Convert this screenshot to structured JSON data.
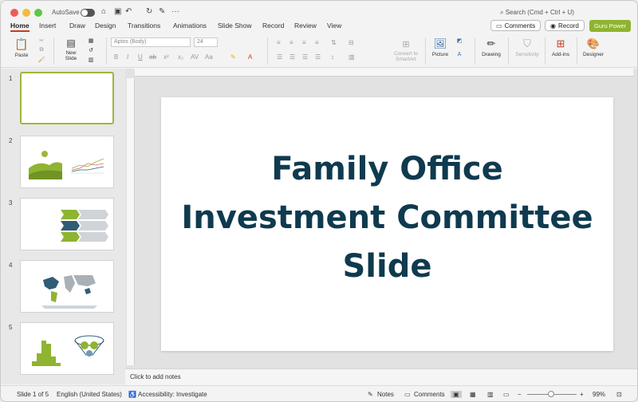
{
  "titlebar": {
    "autosave_label": "AutoSave",
    "search_placeholder": "Search (Cmd + Ctrl + U)"
  },
  "tabs": [
    "Home",
    "Insert",
    "Draw",
    "Design",
    "Transitions",
    "Animations",
    "Slide Show",
    "Record",
    "Review",
    "View"
  ],
  "top_buttons": {
    "comments": "Comments",
    "record": "Record",
    "guru": "Guru Power"
  },
  "ribbon": {
    "paste": "Paste",
    "new_slide": "New Slide",
    "font_name": "Aptos (Body)",
    "font_size": "24",
    "convert": "Convert to SmartArt",
    "picture": "Picture",
    "drawing": "Drawing",
    "sensitivity": "Sensitivity",
    "addins": "Add-ins",
    "designer": "Designer"
  },
  "slides_panel": {
    "numbers": [
      "1",
      "2",
      "3",
      "4",
      "5"
    ]
  },
  "slide": {
    "title_line1": "Family Office",
    "title_line2": "Investment Committee",
    "title_line3": "Slide"
  },
  "notes": {
    "placeholder": "Click to add notes"
  },
  "status": {
    "slide_count": "Slide 1 of 5",
    "language": "English (United States)",
    "accessibility": "Accessibility: Investigate",
    "notes": "Notes",
    "comments": "Comments",
    "zoom": "99%"
  },
  "colors": {
    "title": "#0f3a4f",
    "accent_green": "#8fb430",
    "selected_border": "#a3b43b",
    "tab_underline": "#c43e1c"
  }
}
